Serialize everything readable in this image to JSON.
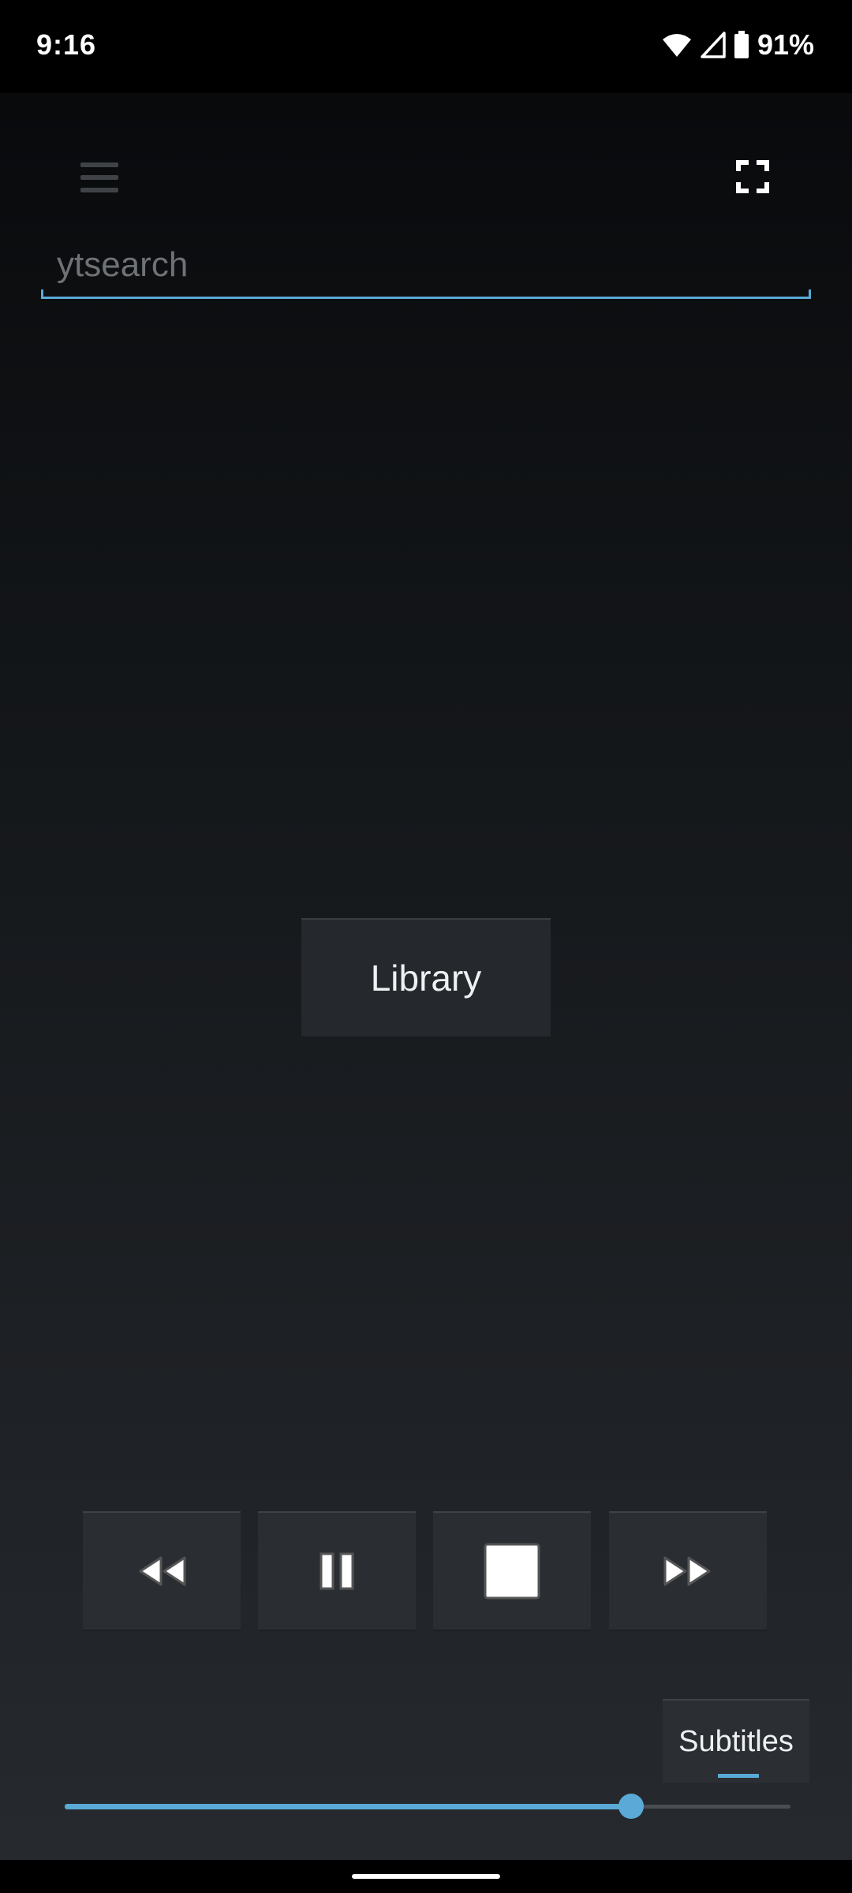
{
  "status_bar": {
    "time": "9:16",
    "battery_percent": "91%",
    "icons": [
      "wifi-icon",
      "cell-signal-icon",
      "battery-icon"
    ]
  },
  "toolbar": {
    "menu_icon": "menu-icon",
    "fullscreen_icon": "fullscreen-icon"
  },
  "search": {
    "placeholder": "ytsearch",
    "value": ""
  },
  "library": {
    "label": "Library"
  },
  "playback_controls": [
    {
      "name": "rewind",
      "icon": "rewind-icon"
    },
    {
      "name": "pause",
      "icon": "pause-icon"
    },
    {
      "name": "stop",
      "icon": "stop-icon"
    },
    {
      "name": "fast-forward",
      "icon": "fast-forward-icon"
    }
  ],
  "subtitles": {
    "label": "Subtitles"
  },
  "seekbar": {
    "position_fraction": 0.78
  },
  "colors": {
    "accent": "#5aa9d6",
    "button_bg": "#2a2e32",
    "text": "#eef0f2"
  }
}
